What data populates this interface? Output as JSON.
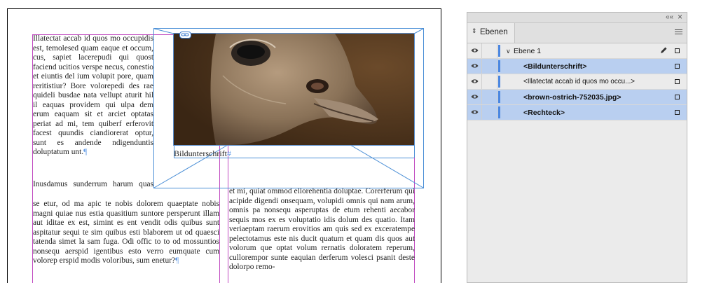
{
  "document": {
    "column1_text": "Illatectat accab id quos mo occupidis est, temolesed quam eaque et occum, cus, sapiet lacerepudi qui quost faciend ucitios verspe necus, conestio et eiuntis del ium volupit pore, quam reritistiur? Bore volorepedi des rae quideli busdae nata vellupt aturit hil il eaquas providem qui ulpa dem erum eaquam sit et arciet optatas periat ad mi, tem quiberf erferovit facest quundis ciandiorerat optur, sunt es andende ndigenduntis doluptatum unt.",
    "column1_para2_lead": "Inusdamus sunderrum harum quas dictem liquost quiditia non-",
    "column1_para2_full": "se etur, od ma apic te nobis dolorem quaeptate nobis magni quiae nus estia quasitium suntore persperunt illam aut iditae ex est, simint es ent vendit odis quibus sunt aspitatur sequi te sim quibus esti blaborem ut od quaesci tatenda simet la sam fuga. Odi offic to to od mossuntios nonsequ aerspid igentibus esto verro eumquate cum volorep erspid modis voloribus, sum enetur?",
    "column2_text": "et mi, quiat ommod ellorehentia doluptae. Corerferum qui acipide digendi onsequam, volupidi omnis qui nam arum, omnis pa nonsequ asperuptas de etum rehenti aecabor sequis mos ex es voluptatio idis dolum des quatio. Itam veriaeptam raerum erovitios am quis sed ex exceratempe pelectotamus este nis ducit quatum et quam dis quos aut volorum que optat volum rernatis doloratem reperum, cullorempor sunte eaquian derferum volesci psanit deste dolorpo remo-",
    "pilcrow": "¶",
    "story_end": "#",
    "caption": "Bildunterschrift"
  },
  "panel": {
    "collapse_glyph": "««",
    "close_glyph": "×",
    "tab_arrows": "⇕",
    "tab_label": "Ebenen",
    "layers": [
      {
        "label": "Ebene 1",
        "bold": false,
        "selected": false,
        "is_parent": true
      },
      {
        "label": "<Bildunterschrift>",
        "bold": true,
        "selected": true
      },
      {
        "label": "<Illatectat accab id quos mo occu...>",
        "bold": false,
        "selected": false
      },
      {
        "label": "<brown-ostrich-752035.jpg>",
        "bold": true,
        "selected": true
      },
      {
        "label": "<Rechteck>",
        "bold": true,
        "selected": true
      }
    ]
  },
  "icons": {
    "visibility": "eye-icon",
    "pen": "pen-icon",
    "menu": "panel-menu-icon",
    "link": "link-icon"
  },
  "colors": {
    "selection": "#b9cff0",
    "layer_color": "#4a86e0",
    "margin_guide": "#c14bc1",
    "frame_edge": "#4b8fd6"
  }
}
